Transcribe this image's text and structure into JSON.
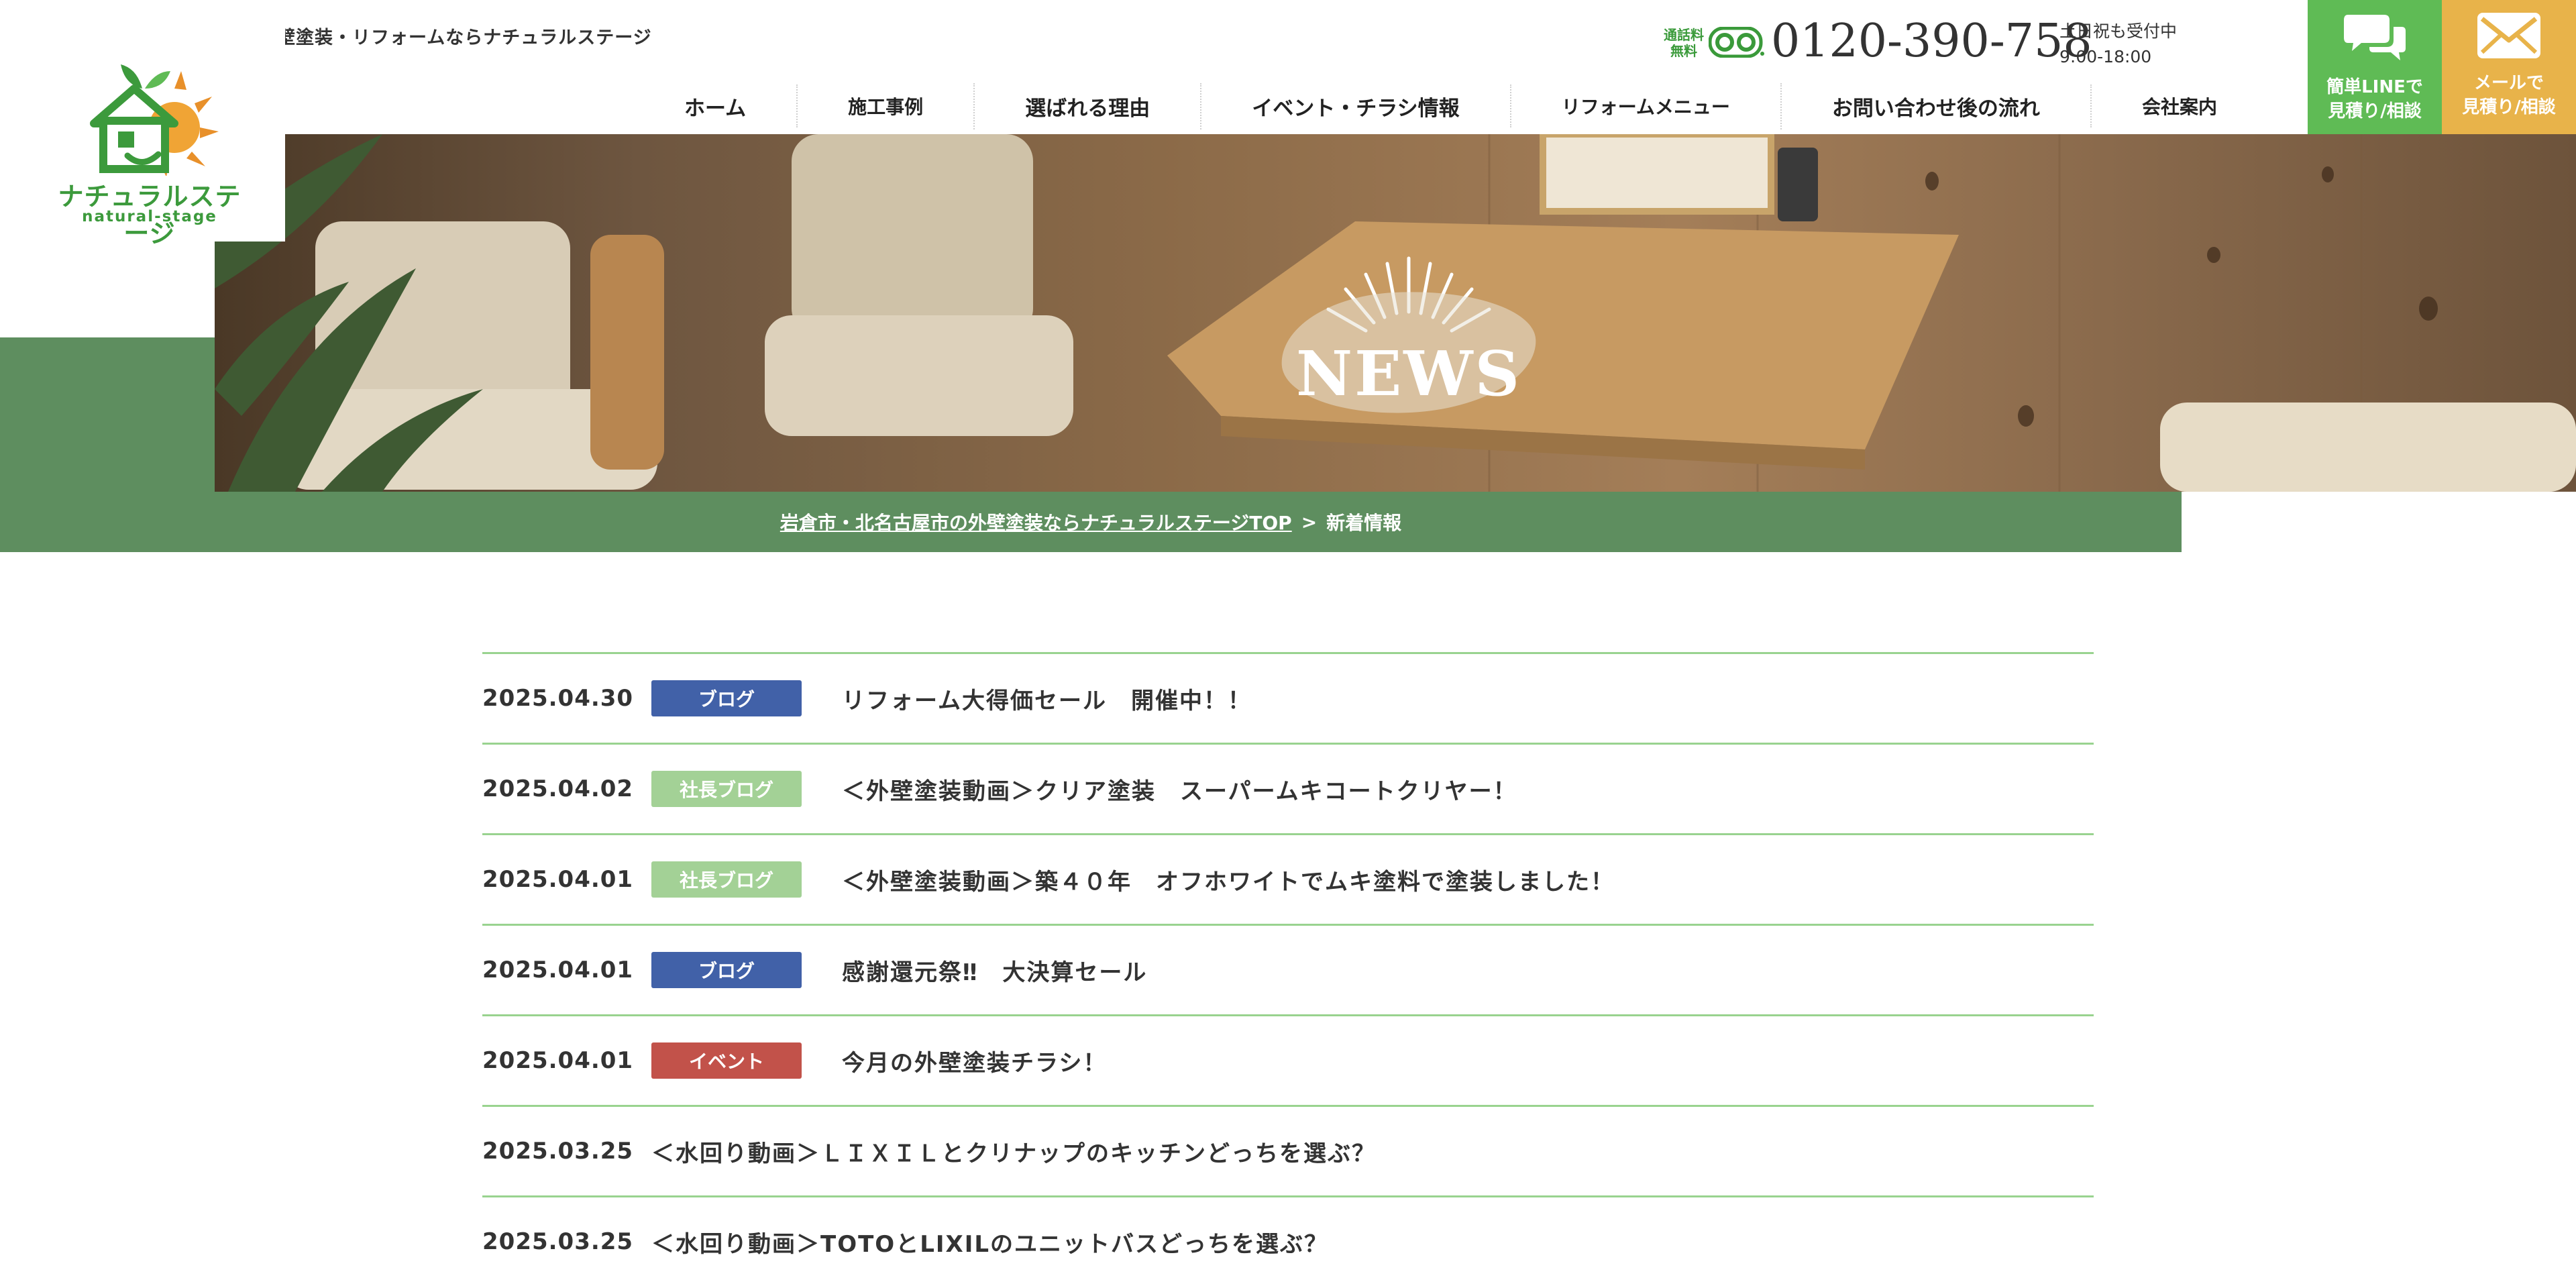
{
  "header": {
    "tagline": "岩倉市、北名古屋市の外壁塗装・リフォームならナチュラルステージ",
    "logo": {
      "name": "ナチュラルステージ",
      "sub": "natural-stage"
    },
    "phone": {
      "free_label_1": "通話料",
      "free_label_2": "無料",
      "number": "0120-390-758",
      "hours_1": "土日祝も受付中",
      "hours_2": "9:00-18:00"
    },
    "cta_line": {
      "line1": "簡単LINEで",
      "line2": "見積り/相談",
      "color": "#5fbb55"
    },
    "cta_mail": {
      "line1": "メールで",
      "line2": "見積り/相談",
      "color": "#e8b34a"
    },
    "nav": [
      "ホーム",
      "施工事例",
      "選ばれる理由",
      "イベント・チラシ情報",
      "リフォームメニュー",
      "お問い合わせ後の流れ",
      "会社案内"
    ]
  },
  "hero": {
    "title": "NEWS"
  },
  "breadcrumb": {
    "home": "岩倉市・北名古屋市の外壁塗装ならナチュラルステージTOP",
    "separator": ">",
    "current": "新着情報"
  },
  "colors": {
    "brand_green": "#5e8e5f",
    "row_divider": "#99d38f",
    "badge_blog": "#4161a8",
    "badge_ceo_blog": "#a3d196",
    "badge_event": "#c2524a"
  },
  "news": [
    {
      "date": "2025.04.30",
      "category": "ブログ",
      "badge_color": "#4161a8",
      "title": "リフォーム大得価セール　開催中！！"
    },
    {
      "date": "2025.04.02",
      "category": "社長ブログ",
      "badge_color": "#a3d196",
      "title": "＜外壁塗装動画＞クリア塗装　スーパームキコートクリヤー！"
    },
    {
      "date": "2025.04.01",
      "category": "社長ブログ",
      "badge_color": "#a3d196",
      "title": "＜外壁塗装動画＞築４０年　オフホワイトでムキ塗料で塗装しました！"
    },
    {
      "date": "2025.04.01",
      "category": "ブログ",
      "badge_color": "#4161a8",
      "title": "感謝還元祭‼　大決算セール"
    },
    {
      "date": "2025.04.01",
      "category": "イベント",
      "badge_color": "#c2524a",
      "title": "今月の外壁塗装チラシ！"
    },
    {
      "date": "2025.03.25",
      "category": "",
      "badge_color": "",
      "title": "＜水回り動画＞ＬＩＸＩＬとクリナップのキッチンどっちを選ぶ？"
    },
    {
      "date": "2025.03.25",
      "category": "",
      "badge_color": "",
      "title": "＜水回り動画＞TOTOとLIXILのユニットバスどっちを選ぶ？"
    }
  ]
}
